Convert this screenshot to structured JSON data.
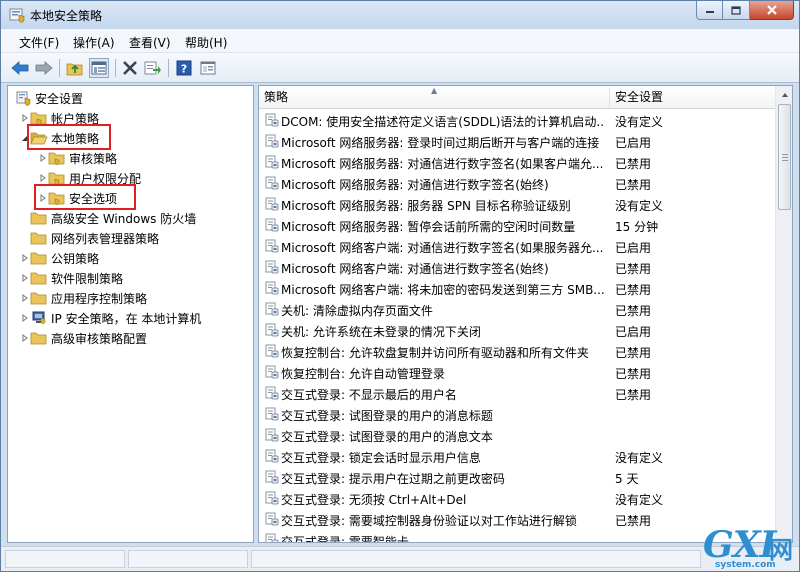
{
  "window": {
    "title": "本地安全策略",
    "controls": [
      "minimize-icon",
      "maximize-icon",
      "close-icon"
    ]
  },
  "menu": {
    "file": "文件(F)",
    "action": "操作(A)",
    "view": "查看(V)",
    "help": "帮助(H)"
  },
  "toolbar": {
    "icons": [
      "back-icon",
      "forward-icon",
      "up-folder-icon",
      "show-hide-tree-icon",
      "delete-icon",
      "export-icon",
      "help-icon",
      "properties-icon"
    ]
  },
  "tree": {
    "root": "安全设置",
    "items": [
      {
        "label": "帐户策略"
      },
      {
        "label": "本地策略"
      },
      {
        "label": "审核策略"
      },
      {
        "label": "用户权限分配"
      },
      {
        "label": "安全选项"
      },
      {
        "label": "高级安全 Windows 防火墙"
      },
      {
        "label": "网络列表管理器策略"
      },
      {
        "label": "公钥策略"
      },
      {
        "label": "软件限制策略"
      },
      {
        "label": "应用程序控制策略"
      },
      {
        "label": "IP 安全策略，在 本地计算机"
      },
      {
        "label": "高级审核策略配置"
      }
    ]
  },
  "list": {
    "columns": {
      "policy": "策略",
      "setting": "安全设置"
    },
    "rows": [
      {
        "policy": "DCOM: 使用安全描述符定义语言(SDDL)语法的计算机启动...",
        "setting": "没有定义"
      },
      {
        "policy": "Microsoft 网络服务器: 登录时间过期后断开与客户端的连接",
        "setting": "已启用"
      },
      {
        "policy": "Microsoft 网络服务器: 对通信进行数字签名(如果客户端允...",
        "setting": "已禁用"
      },
      {
        "policy": "Microsoft 网络服务器: 对通信进行数字签名(始终)",
        "setting": "已禁用"
      },
      {
        "policy": "Microsoft 网络服务器: 服务器 SPN 目标名称验证级别",
        "setting": "没有定义"
      },
      {
        "policy": "Microsoft 网络服务器: 暂停会话前所需的空闲时间数量",
        "setting": "15 分钟"
      },
      {
        "policy": "Microsoft 网络客户端: 对通信进行数字签名(如果服务器允...",
        "setting": "已启用"
      },
      {
        "policy": "Microsoft 网络客户端: 对通信进行数字签名(始终)",
        "setting": "已禁用"
      },
      {
        "policy": "Microsoft 网络客户端: 将未加密的密码发送到第三方 SMB...",
        "setting": "已禁用"
      },
      {
        "policy": "关机: 清除虚拟内存页面文件",
        "setting": "已禁用"
      },
      {
        "policy": "关机: 允许系统在未登录的情况下关闭",
        "setting": "已启用"
      },
      {
        "policy": "恢复控制台: 允许软盘复制并访问所有驱动器和所有文件夹",
        "setting": "已禁用"
      },
      {
        "policy": "恢复控制台: 允许自动管理登录",
        "setting": "已禁用"
      },
      {
        "policy": "交互式登录: 不显示最后的用户名",
        "setting": "已禁用"
      },
      {
        "policy": "交互式登录: 试图登录的用户的消息标题",
        "setting": ""
      },
      {
        "policy": "交互式登录: 试图登录的用户的消息文本",
        "setting": ""
      },
      {
        "policy": "交互式登录: 锁定会话时显示用户信息",
        "setting": "没有定义"
      },
      {
        "policy": "交互式登录: 提示用户在过期之前更改密码",
        "setting": "5 天"
      },
      {
        "policy": "交互式登录: 无须按 Ctrl+Alt+Del",
        "setting": "没有定义"
      },
      {
        "policy": "交互式登录: 需要域控制器身份验证以对工作站进行解锁",
        "setting": "已禁用"
      },
      {
        "policy": "交互式登录: 需要智能卡",
        "setting": ""
      }
    ]
  },
  "watermark": {
    "big": "GXI",
    "cn": "网",
    "small": "system.com"
  },
  "colors": {
    "highlight_box": "#e02020",
    "title_bg": "#cfdff0",
    "folder": "#e8c45a",
    "watermark": "#2f8ed0"
  }
}
